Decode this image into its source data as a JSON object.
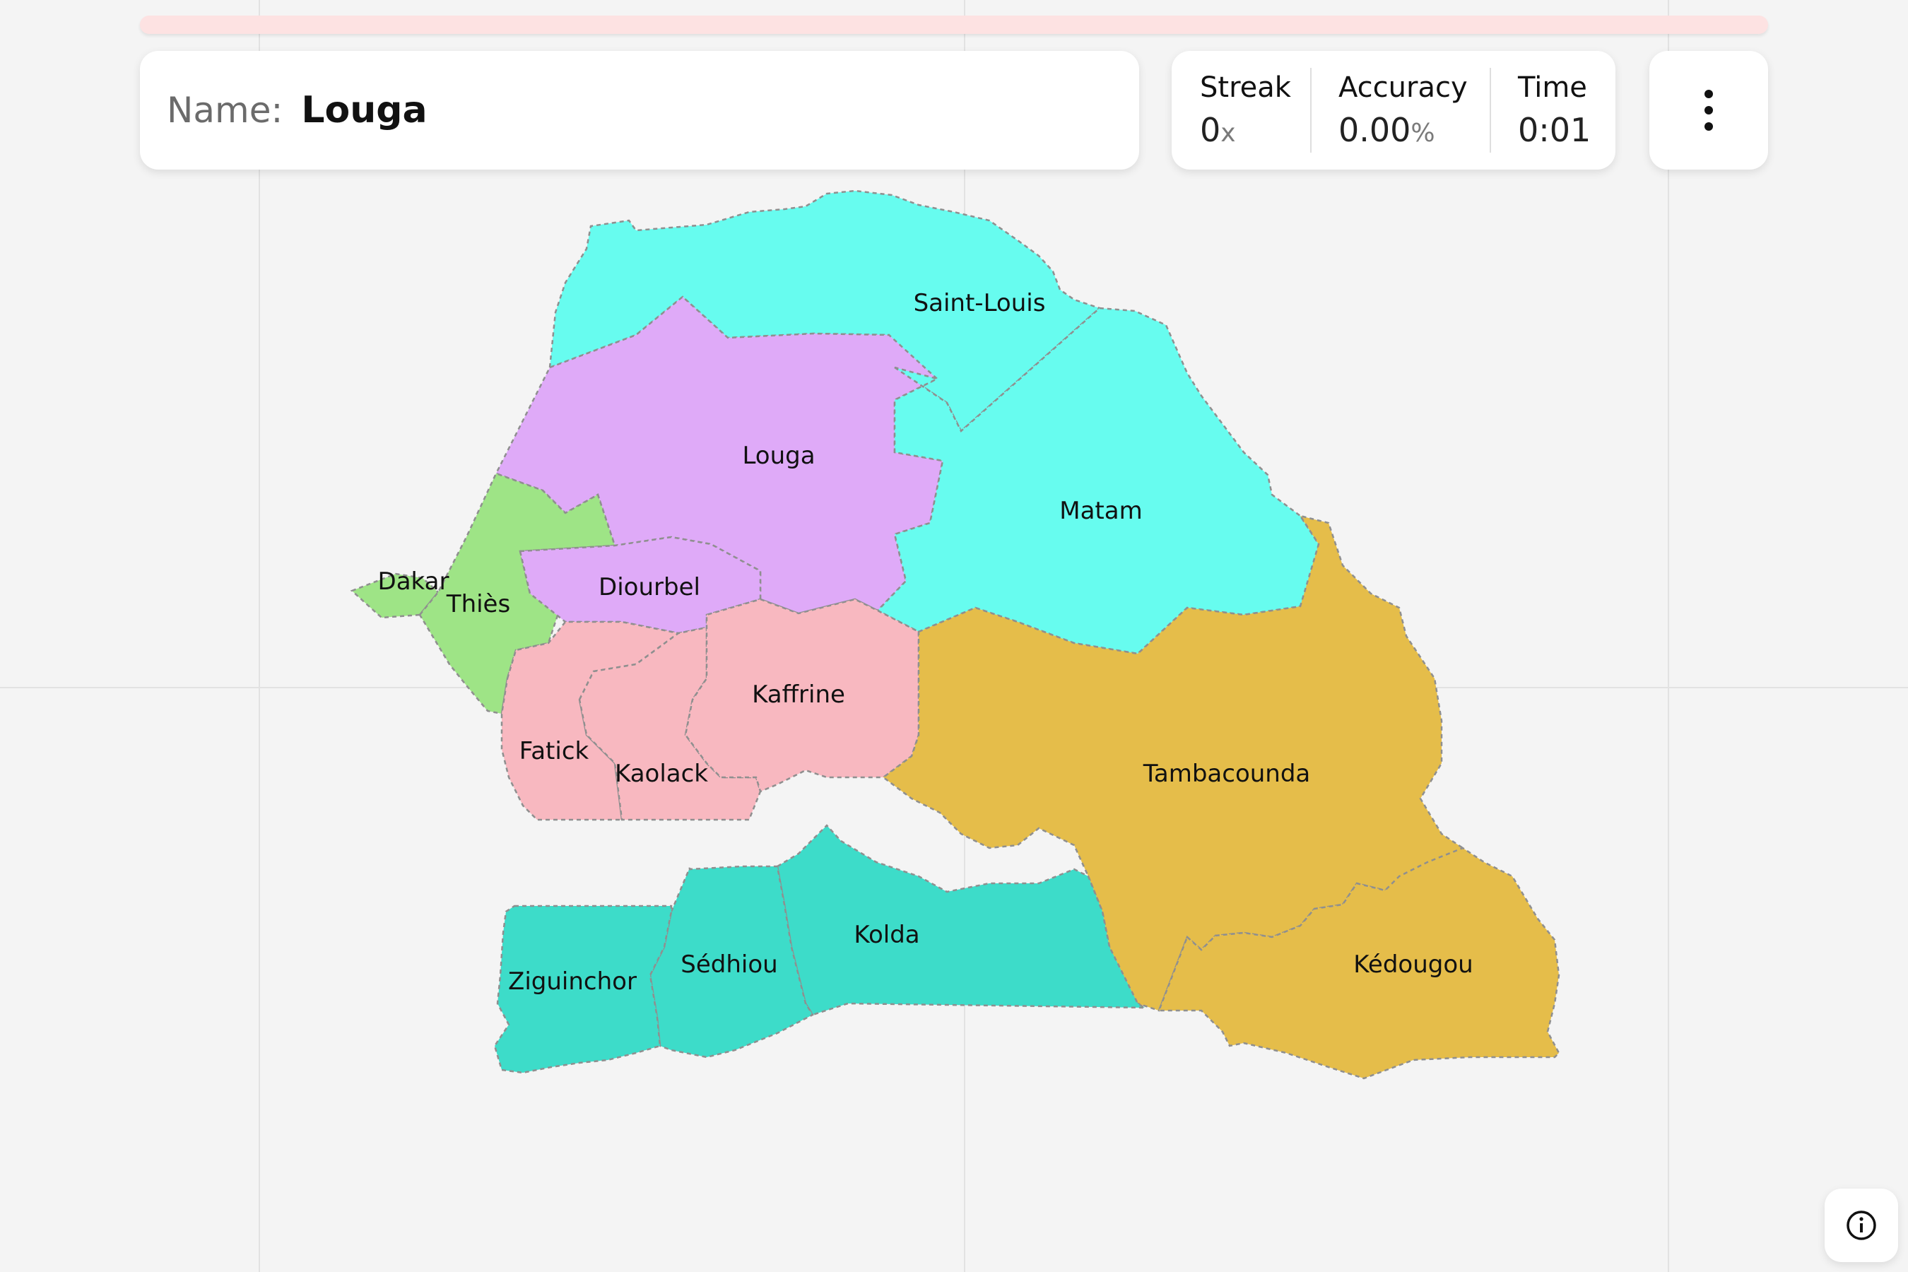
{
  "quiz": {
    "progress_fraction": 0.0
  },
  "prompt": {
    "label": "Name:",
    "value": "Louga"
  },
  "stats": {
    "streak_label": "Streak",
    "streak_value": "0",
    "streak_unit": "x",
    "accuracy_label": "Accuracy",
    "accuracy_value": "0.00",
    "accuracy_unit": "%",
    "time_label": "Time",
    "time_value": "0:01"
  },
  "menu": {
    "icon": "more-vertical-icon"
  },
  "info": {
    "icon": "info-icon"
  },
  "colors": {
    "cyan": "#67fcef",
    "purple": "#dfaaf8",
    "green": "#9ee486",
    "pink": "#f8b8c0",
    "gold": "#e5bd4a",
    "teal": "#3ddcc9",
    "progress_track": "#fde2e2"
  },
  "regions": [
    {
      "id": "saint-louis",
      "label": "Saint-Louis",
      "color": "cyan"
    },
    {
      "id": "louga",
      "label": "Louga",
      "color": "purple"
    },
    {
      "id": "matam",
      "label": "Matam",
      "color": "cyan"
    },
    {
      "id": "dakar",
      "label": "Dakar",
      "color": "green"
    },
    {
      "id": "thies",
      "label": "Thiès",
      "color": "green"
    },
    {
      "id": "diourbel",
      "label": "Diourbel",
      "color": "purple"
    },
    {
      "id": "kaffrine",
      "label": "Kaffrine",
      "color": "pink"
    },
    {
      "id": "fatick",
      "label": "Fatick",
      "color": "pink"
    },
    {
      "id": "kaolack",
      "label": "Kaolack",
      "color": "pink"
    },
    {
      "id": "tambacounda",
      "label": "Tambacounda",
      "color": "gold"
    },
    {
      "id": "kolda",
      "label": "Kolda",
      "color": "teal"
    },
    {
      "id": "sedhiou",
      "label": "Sédhiou",
      "color": "teal"
    },
    {
      "id": "ziguinchor",
      "label": "Ziguinchor",
      "color": "teal"
    },
    {
      "id": "kedougou",
      "label": "Kédougou",
      "color": "gold"
    }
  ]
}
